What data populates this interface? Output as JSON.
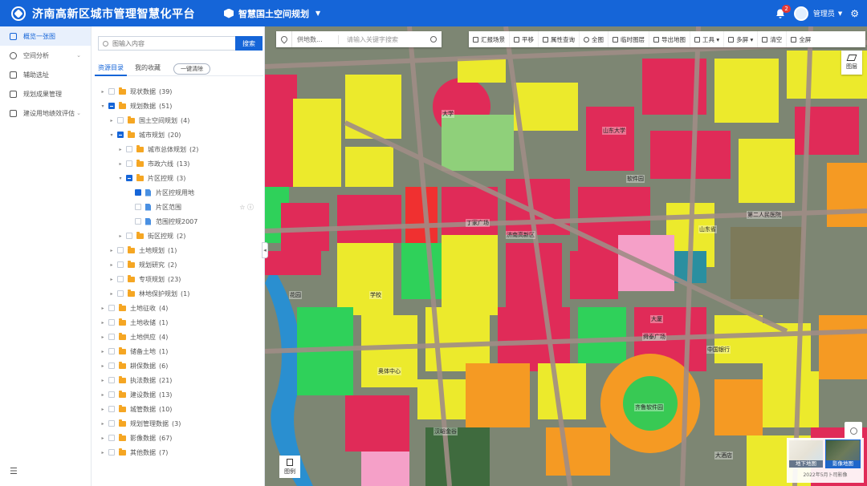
{
  "header": {
    "app_title": "济南高新区城市管理智慧化平台",
    "module": "智慧国土空间规划",
    "notifications": "2",
    "user": "管理员",
    "colors": {
      "primary": "#1565d8"
    }
  },
  "leftnav": {
    "items": [
      {
        "label": "概览一张图",
        "icon": "layers-icon",
        "active": true
      },
      {
        "label": "空间分析",
        "icon": "globe-icon",
        "active": false
      },
      {
        "label": "辅助选址",
        "icon": "location-icon",
        "active": false
      },
      {
        "label": "规划成果管理",
        "icon": "folder-icon",
        "active": false
      },
      {
        "label": "建设用地绩效评估",
        "icon": "chart-icon",
        "active": false
      }
    ],
    "bottom_icon": "menu-icon"
  },
  "panel": {
    "search": {
      "placeholder": "图输入内容",
      "button": "搜索"
    },
    "tabs": [
      "资源目录",
      "我的收藏"
    ],
    "clear_button": "一键清除",
    "tree": [
      {
        "label": "现状数据",
        "count": "(39)",
        "level": 0,
        "type": "folder",
        "check": "off",
        "arrow": "▸"
      },
      {
        "label": "规划数据",
        "count": "(51)",
        "level": 0,
        "type": "folder",
        "check": "half",
        "arrow": "▾"
      },
      {
        "label": "国土空间规划",
        "count": "(4)",
        "level": 1,
        "type": "folder",
        "check": "off",
        "arrow": "▸"
      },
      {
        "label": "城市规划",
        "count": "(20)",
        "level": 1,
        "type": "folder",
        "check": "half",
        "arrow": "▾"
      },
      {
        "label": "城市总体规划",
        "count": "(2)",
        "level": 2,
        "type": "folder",
        "check": "off",
        "arrow": "▸"
      },
      {
        "label": "市政六线",
        "count": "(13)",
        "level": 2,
        "type": "folder",
        "check": "off",
        "arrow": "▸"
      },
      {
        "label": "片区控规",
        "count": "(3)",
        "level": 2,
        "type": "folder",
        "check": "half",
        "arrow": "▾"
      },
      {
        "label": "片区控规用地",
        "count": "",
        "level": 3,
        "type": "doc",
        "check": "on",
        "arrow": ""
      },
      {
        "label": "片区范围",
        "count": "",
        "level": 3,
        "type": "doc",
        "check": "off",
        "arrow": "",
        "tools": "☆ ⓘ"
      },
      {
        "label": "范围控规2007",
        "count": "",
        "level": 3,
        "type": "doc",
        "check": "off",
        "arrow": ""
      },
      {
        "label": "街区控规",
        "count": "(2)",
        "level": 2,
        "type": "folder",
        "check": "off",
        "arrow": "▸"
      },
      {
        "label": "土地规划",
        "count": "(1)",
        "level": 1,
        "type": "folder",
        "check": "off",
        "arrow": "▸"
      },
      {
        "label": "规划研究",
        "count": "(2)",
        "level": 1,
        "type": "folder",
        "check": "off",
        "arrow": "▸"
      },
      {
        "label": "专项规划",
        "count": "(23)",
        "level": 1,
        "type": "folder",
        "check": "off",
        "arrow": "▸"
      },
      {
        "label": "林地保护规划",
        "count": "(1)",
        "level": 1,
        "type": "folder",
        "check": "off",
        "arrow": "▸"
      },
      {
        "label": "土地征收",
        "count": "(4)",
        "level": 0,
        "type": "folder",
        "check": "off",
        "arrow": "▸"
      },
      {
        "label": "土地收储",
        "count": "(1)",
        "level": 0,
        "type": "folder",
        "check": "off",
        "arrow": "▸"
      },
      {
        "label": "土地供应",
        "count": "(4)",
        "level": 0,
        "type": "folder",
        "check": "off",
        "arrow": "▸"
      },
      {
        "label": "储备土地",
        "count": "(1)",
        "level": 0,
        "type": "folder",
        "check": "off",
        "arrow": "▸"
      },
      {
        "label": "耕保数据",
        "count": "(6)",
        "level": 0,
        "type": "folder",
        "check": "off",
        "arrow": "▸"
      },
      {
        "label": "执法数据",
        "count": "(21)",
        "level": 0,
        "type": "folder",
        "check": "off",
        "arrow": "▸"
      },
      {
        "label": "建设数据",
        "count": "(13)",
        "level": 0,
        "type": "folder",
        "check": "off",
        "arrow": "▸"
      },
      {
        "label": "城管数据",
        "count": "(10)",
        "level": 0,
        "type": "folder",
        "check": "off",
        "arrow": "▸"
      },
      {
        "label": "规划管理数据",
        "count": "(3)",
        "level": 0,
        "type": "folder",
        "check": "off",
        "arrow": "▸"
      },
      {
        "label": "影像数据",
        "count": "(67)",
        "level": 0,
        "type": "folder",
        "check": "off",
        "arrow": "▸"
      },
      {
        "label": "其他数据",
        "count": "(7)",
        "level": 0,
        "type": "folder",
        "check": "off",
        "arrow": "▸"
      }
    ]
  },
  "map": {
    "search": {
      "select": "供地数...",
      "placeholder": "请输入关键字搜索"
    },
    "toolbar": [
      "汇报场景",
      "平移",
      "属性查询",
      "全图",
      "临时图层",
      "导出地图",
      "工具",
      "多屏",
      "清空",
      "全屏"
    ],
    "layers_label": "图层",
    "legend_label": "图例",
    "basemaps": {
      "vector": "地下地图",
      "image": "影像地图"
    },
    "copyright": "2022年5月卜司影像",
    "labels": [
      "大学",
      "齐鲁软件园",
      "山东大学",
      "丁家广场",
      "济南高新区",
      "大厦",
      "软件园",
      "山东省",
      "舜泰广场",
      "中国银行",
      "奥体中心",
      "学校",
      "第二人民医院",
      "汉峪金谷",
      "花园",
      "大酒店"
    ]
  }
}
